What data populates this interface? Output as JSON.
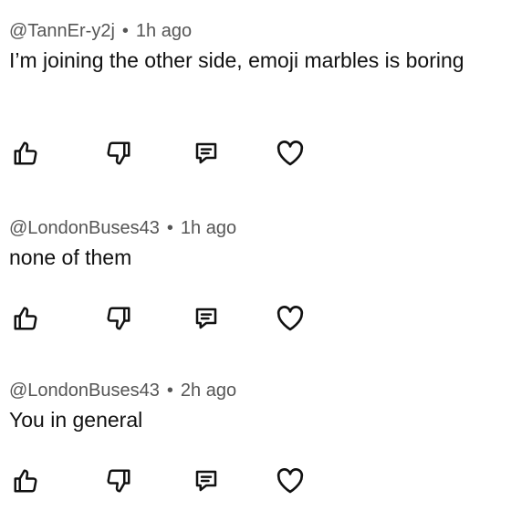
{
  "comments": [
    {
      "author": "@TannEr-y2j",
      "time": "1h ago",
      "text": "I’m joining the other side, emoji marbles is boring"
    },
    {
      "author": "@LondonBuses43",
      "time": "1h ago",
      "text": "none of them"
    },
    {
      "author": "@LondonBuses43",
      "time": "2h ago",
      "text": "You in general"
    }
  ],
  "separator": "•",
  "icons": [
    "thumbs-up-icon",
    "thumbs-down-icon",
    "reply-icon",
    "heart-icon"
  ]
}
